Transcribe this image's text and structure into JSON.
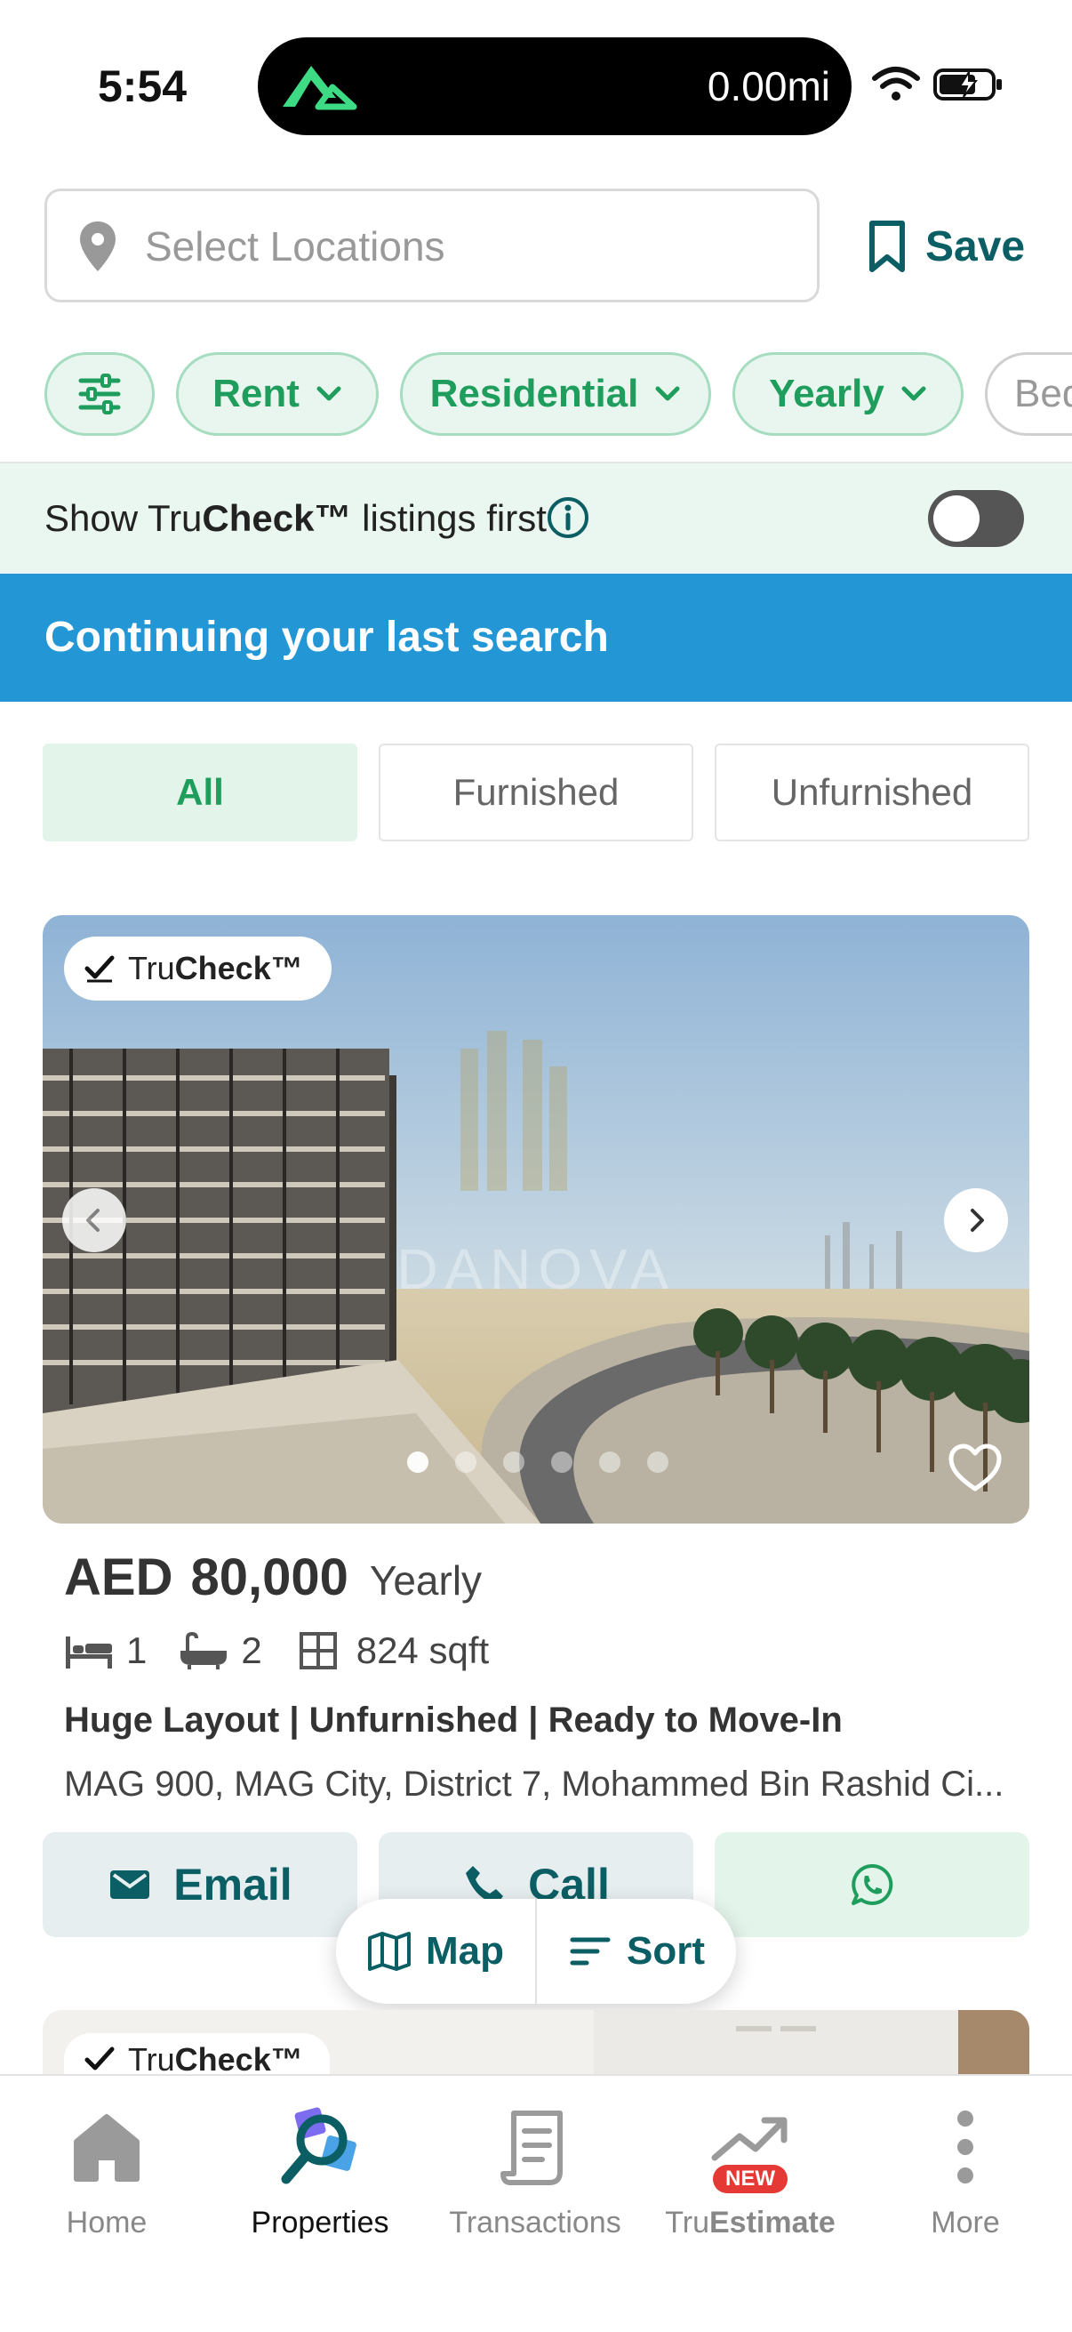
{
  "status_bar": {
    "time": "5:54",
    "island_text": "0.00mi"
  },
  "search": {
    "placeholder": "Select Locations",
    "save_label": "Save"
  },
  "filters": {
    "chips": [
      "Rent",
      "Residential",
      "Yearly",
      "Bed"
    ]
  },
  "trucheck": {
    "prefix": "Show Tru",
    "bold": "Check™",
    "suffix": " listings first",
    "enabled": false
  },
  "banner": {
    "text": "Continuing your last search"
  },
  "tabs": [
    {
      "label": "All",
      "active": true
    },
    {
      "label": "Furnished",
      "active": false
    },
    {
      "label": "Unfurnished",
      "active": false
    }
  ],
  "listing": {
    "badge_prefix": "Tru",
    "badge_bold": "Check™",
    "image_watermark": "DANOVA",
    "photo_count": 6,
    "photo_index": 1,
    "currency": "AED",
    "price": "80,000",
    "period": "Yearly",
    "beds": "1",
    "baths": "2",
    "area": "824 sqft",
    "title": "Huge Layout | Unfurnished | Ready to Move-In",
    "address": "MAG 900, MAG City, District 7, Mohammed Bin Rashid Ci...",
    "email_label": "Email",
    "call_label": "Call"
  },
  "float_bar": {
    "map_label": "Map",
    "sort_label": "Sort"
  },
  "next_listing": {
    "badge_prefix": "Tru",
    "badge_bold": "Check™"
  },
  "bottom_nav": {
    "items": [
      {
        "label": "Home",
        "icon": "home-icon"
      },
      {
        "label": "Properties",
        "icon": "properties-search-icon"
      },
      {
        "label": "Transactions",
        "icon": "transactions-icon"
      },
      {
        "label_prefix": "Tru",
        "label_bold": "Estimate",
        "icon": "trend-icon",
        "badge": "NEW"
      },
      {
        "label": "More",
        "icon": "more-dots-icon"
      }
    ],
    "active": "Properties"
  },
  "colors": {
    "brand_teal": "#0b5e63",
    "chip_green": "#1f9d5c",
    "banner_blue": "#2397d6",
    "new_badge_red": "#e53935"
  }
}
